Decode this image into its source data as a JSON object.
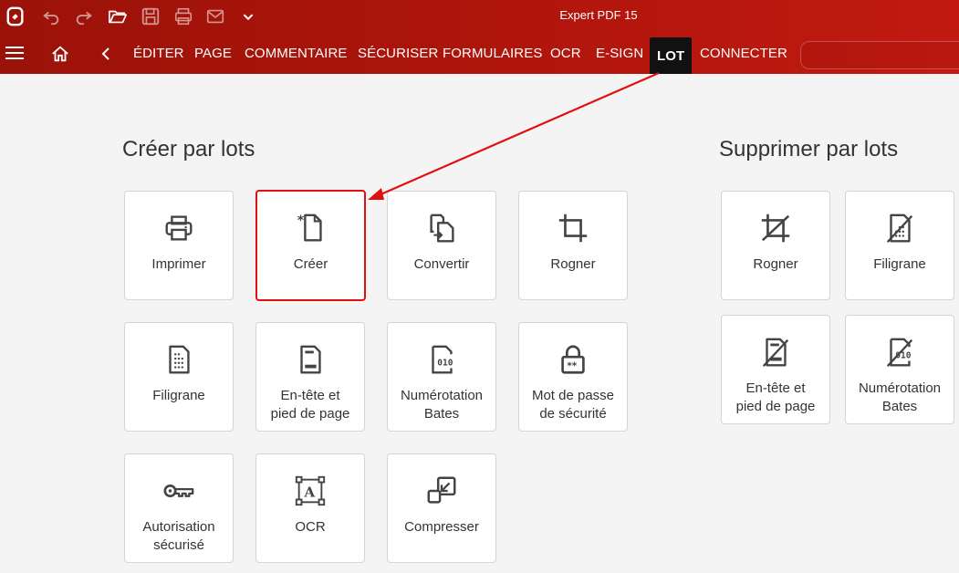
{
  "app": {
    "title": "Expert PDF 15"
  },
  "toolbar": {
    "icons": [
      "app-logo-icon",
      "undo-icon",
      "redo-icon",
      "open-folder-icon",
      "save-icon",
      "print-icon",
      "mail-icon",
      "chevron-down-icon"
    ]
  },
  "nav": {
    "tabs": [
      {
        "label": "ÉDITER"
      },
      {
        "label": "PAGE"
      },
      {
        "label": "COMMENTAIRE"
      },
      {
        "label": "SÉCURISER"
      },
      {
        "label": "FORMULAIRES"
      },
      {
        "label": "OCR"
      },
      {
        "label": "E-SIGN"
      },
      {
        "label": "LOT"
      },
      {
        "label": "CONNECTER"
      }
    ],
    "active_tab": "LOT"
  },
  "create": {
    "title": "Créer par lots",
    "tiles": [
      {
        "label": "Imprimer",
        "icon": "printer-icon"
      },
      {
        "label": "Créer",
        "icon": "new-document-icon"
      },
      {
        "label": "Convertir",
        "icon": "convert-icon"
      },
      {
        "label": "Rogner",
        "icon": "crop-icon"
      },
      {
        "label_line1": "Filigrane",
        "icon": "watermark-icon"
      },
      {
        "label_line1": "En-tête et",
        "label_line2": "pied de page",
        "icon": "header-footer-icon"
      },
      {
        "label_line1": "Numérotation",
        "label_line2": "Bates",
        "icon": "bates-icon"
      },
      {
        "label_line1": "Mot de passe",
        "label_line2": "de sécurité",
        "icon": "password-icon"
      },
      {
        "label_line1": "Autorisation",
        "label_line2": "sécurisé",
        "icon": "key-icon"
      },
      {
        "label_line1": "OCR",
        "icon": "ocr-icon"
      },
      {
        "label_line1": "Compresser",
        "icon": "compress-icon"
      }
    ]
  },
  "remove": {
    "title": "Supprimer par lots",
    "tiles": [
      {
        "label": "Rogner",
        "icon": "remove-crop-icon"
      },
      {
        "label": "Filigrane",
        "icon": "remove-watermark-icon"
      },
      {
        "label_line1": "En-tête et",
        "label_line2": "pied de page",
        "icon": "remove-header-footer-icon"
      },
      {
        "label_line1": "Numérotation",
        "label_line2": "Bates",
        "icon": "remove-bates-icon"
      }
    ]
  },
  "annotation": {
    "color": "#e01010",
    "target": "Créer",
    "source": "LOT"
  }
}
